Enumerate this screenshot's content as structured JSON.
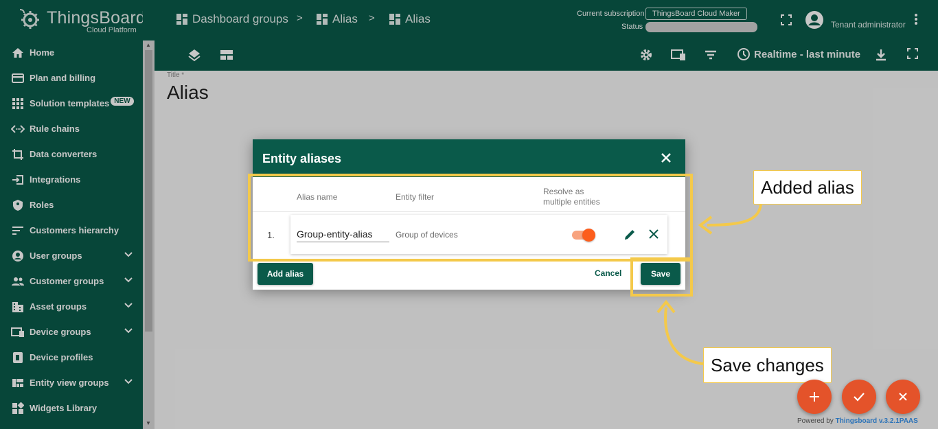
{
  "brand": {
    "name": "ThingsBoard",
    "subtitle": "Cloud Platform"
  },
  "sidebar": {
    "items": [
      {
        "label": "Home",
        "icon": "home-icon"
      },
      {
        "label": "Plan and billing",
        "icon": "billing-card-icon"
      },
      {
        "label": "Solution templates",
        "icon": "apps-grid-icon",
        "badge": "NEW"
      },
      {
        "label": "Rule chains",
        "icon": "code-arrows-icon"
      },
      {
        "label": "Data converters",
        "icon": "crop-icon"
      },
      {
        "label": "Integrations",
        "icon": "input-icon"
      },
      {
        "label": "Roles",
        "icon": "shield-icon"
      },
      {
        "label": "Customers hierarchy",
        "icon": "sort-lines-icon"
      },
      {
        "label": "User groups",
        "icon": "account-circle-icon",
        "expandable": true
      },
      {
        "label": "Customer groups",
        "icon": "people-icon",
        "expandable": true
      },
      {
        "label": "Asset groups",
        "icon": "domain-icon",
        "expandable": true
      },
      {
        "label": "Device groups",
        "icon": "devices-icon",
        "expandable": true
      },
      {
        "label": "Device profiles",
        "icon": "device-profile-icon"
      },
      {
        "label": "Entity view groups",
        "icon": "view-quilt-icon",
        "expandable": true
      },
      {
        "label": "Widgets Library",
        "icon": "widgets-icon"
      }
    ]
  },
  "header": {
    "breadcrumbs": [
      "Dashboard groups",
      "Alias",
      "Alias"
    ],
    "separator": ">",
    "subscription_label": "Current subscription",
    "subscription_value": "ThingsBoard Cloud Maker",
    "status_label": "Status",
    "user": "Tenant administrator"
  },
  "toolbar": {
    "timewindow": "Realtime - last minute"
  },
  "dashboard": {
    "title_label": "Title *",
    "title": "Alias"
  },
  "dialog": {
    "title": "Entity aliases",
    "columns": {
      "alias_name": "Alias name",
      "entity_filter": "Entity filter",
      "resolve_line1": "Resolve as",
      "resolve_line2": "multiple entities"
    },
    "rows": [
      {
        "index": "1.",
        "alias_name": "Group-entity-alias",
        "entity_filter": "Group of devices",
        "resolve_multiple": true
      }
    ],
    "add_alias": "Add alias",
    "cancel": "Cancel",
    "save": "Save"
  },
  "annotations": {
    "added_alias": "Added alias",
    "save_changes": "Save changes",
    "highlight_color": "#f4c94a"
  },
  "footer": {
    "powered_prefix": "Powered by",
    "powered_link": "Thingsboard v.3.2.1PAAS"
  },
  "colors": {
    "primary": "#0a5a4a",
    "accent": "#e4532a",
    "toggle": "#fc5d1c"
  }
}
